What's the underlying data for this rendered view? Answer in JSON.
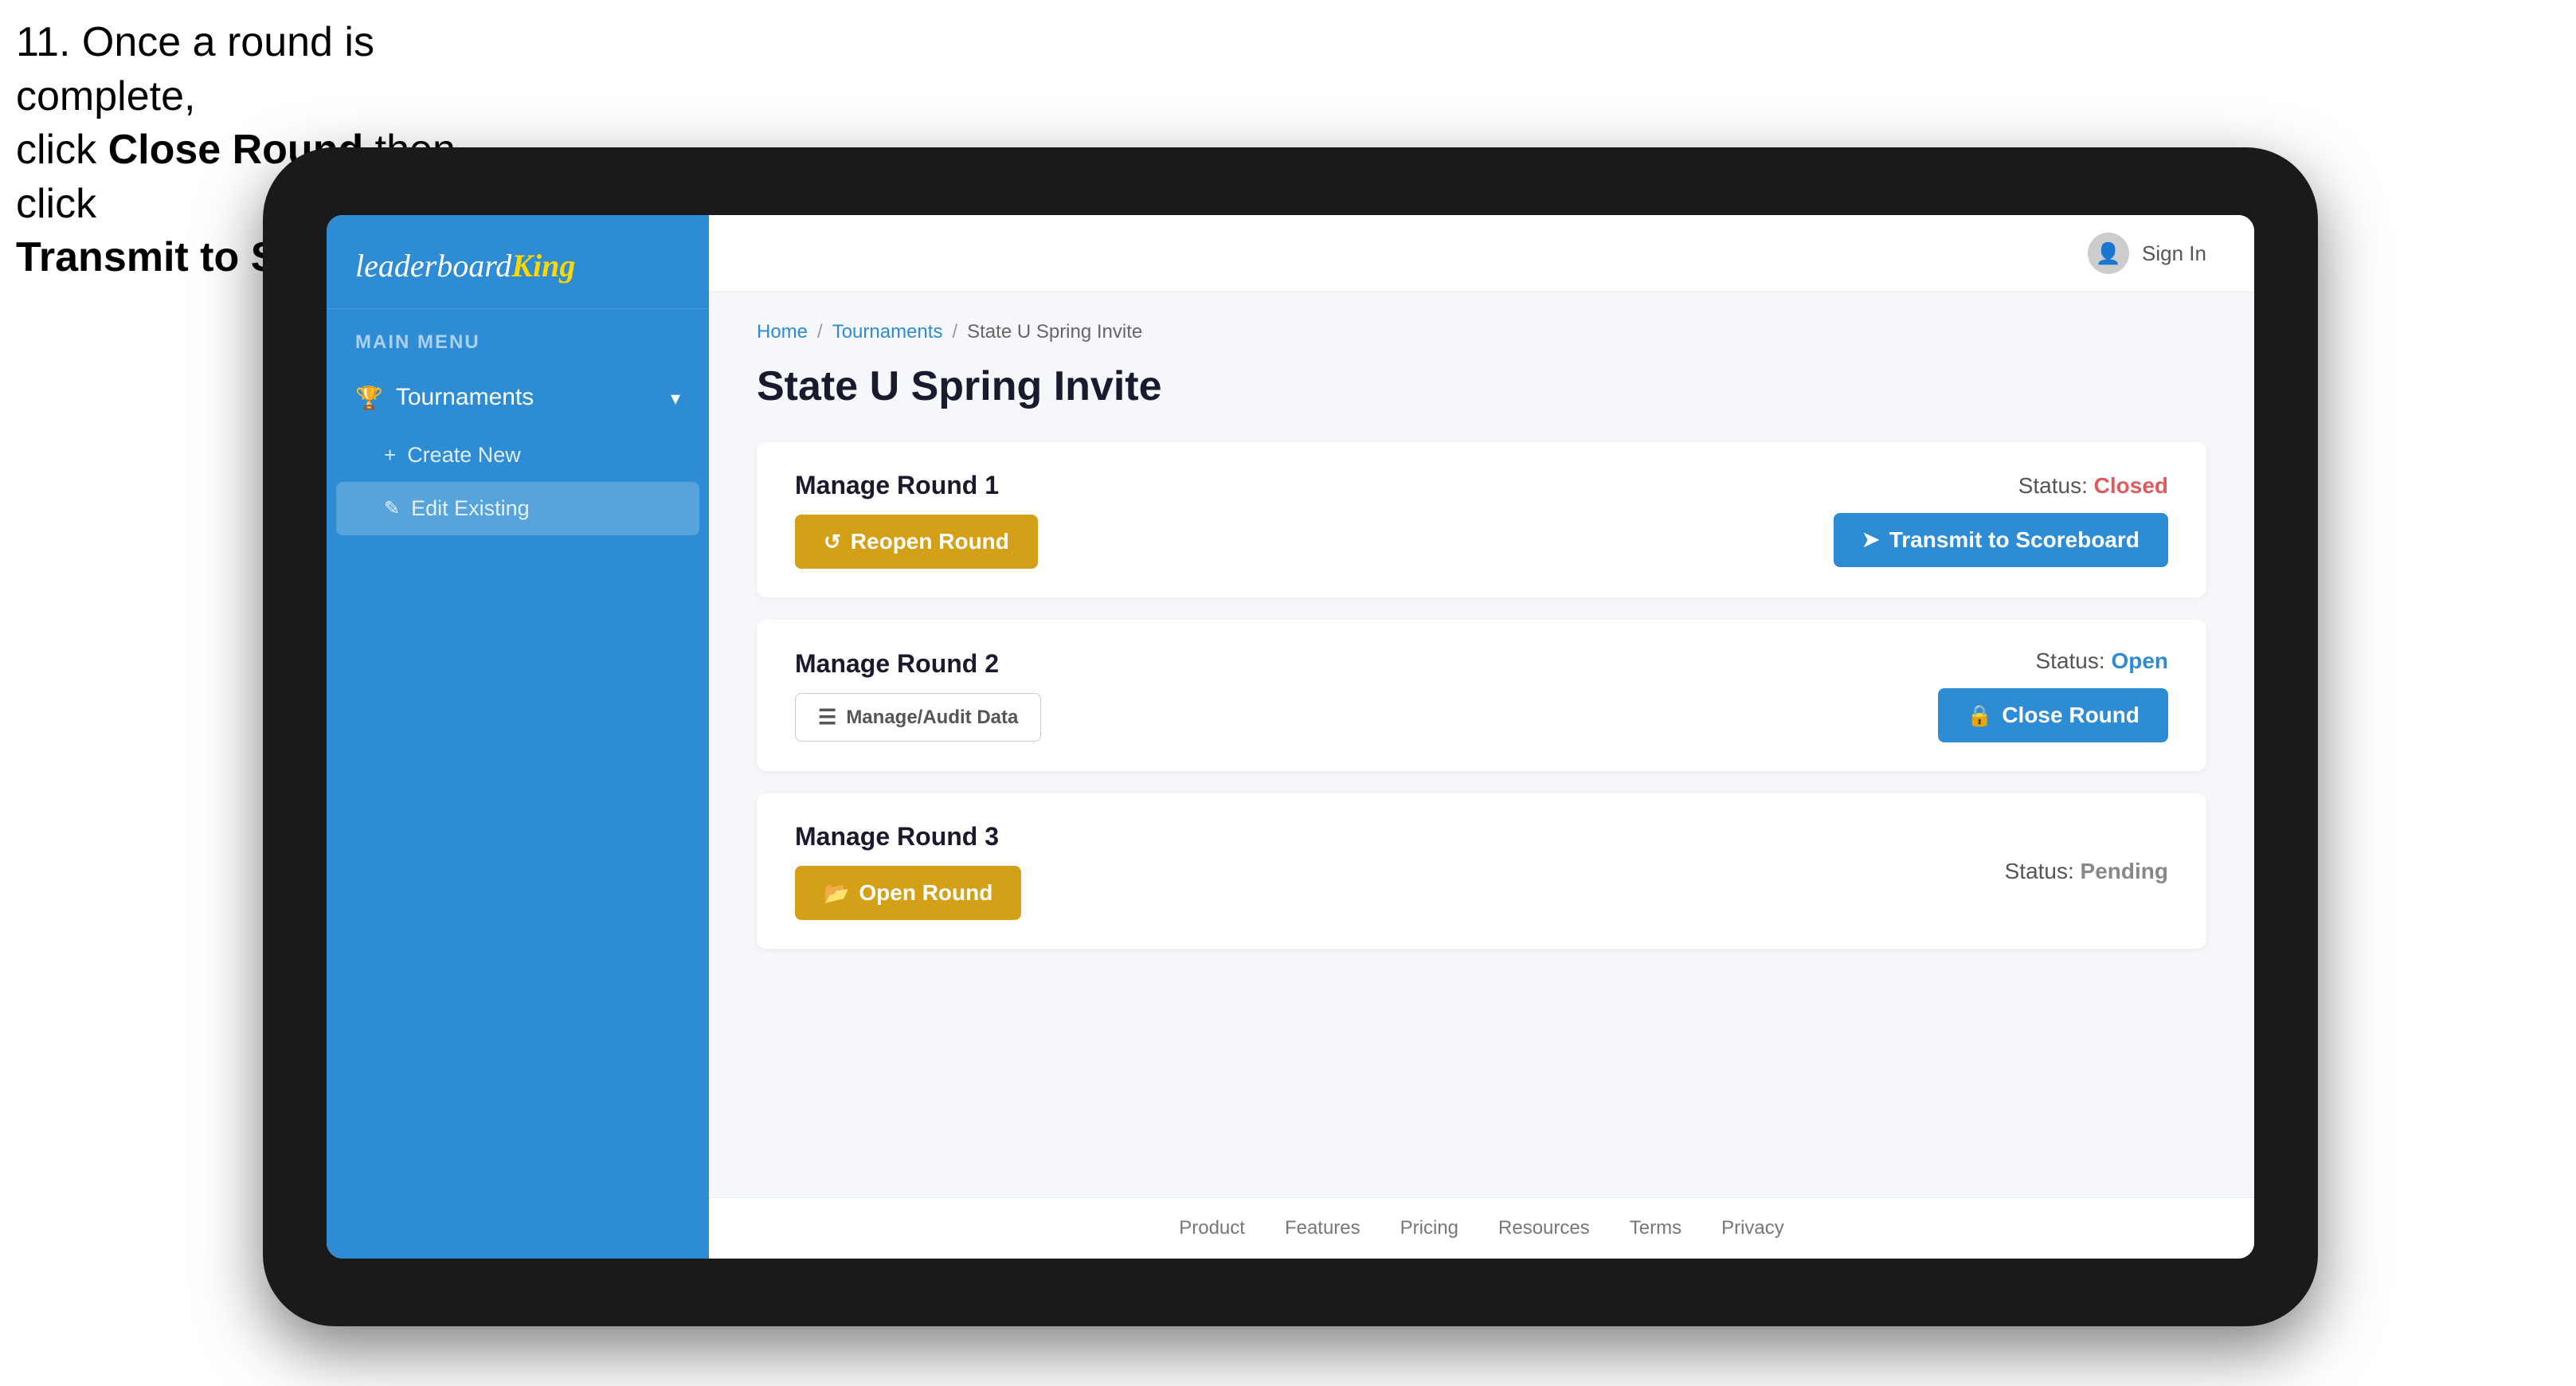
{
  "instruction": {
    "line1": "11. Once a round is complete,",
    "line2": "click ",
    "bold1": "Close Round",
    "line3": " then click",
    "bold2": "Transmit to Scoreboard."
  },
  "logo": {
    "leaderboard": "leaderboard",
    "king": "King"
  },
  "sidebar": {
    "menu_label": "MAIN MENU",
    "tournaments_label": "Tournaments",
    "create_new_label": "Create New",
    "edit_existing_label": "Edit Existing"
  },
  "topnav": {
    "sign_in": "Sign In"
  },
  "breadcrumb": {
    "home": "Home",
    "tournaments": "Tournaments",
    "current": "State U Spring Invite"
  },
  "page": {
    "title": "State U Spring Invite"
  },
  "rounds": [
    {
      "id": "round1",
      "title": "Manage Round 1",
      "status_label": "Status:",
      "status": "Closed",
      "status_class": "status-closed",
      "btn_label": "Reopen Round",
      "btn_class": "btn-orange",
      "btn2_label": "Transmit to Scoreboard",
      "btn2_class": "btn-blue",
      "btn_icon": "↺",
      "btn2_icon": "➤"
    },
    {
      "id": "round2",
      "title": "Manage Round 2",
      "status_label": "Status:",
      "status": "Open",
      "status_class": "status-open",
      "btn_label": "Manage/Audit Data",
      "btn_class": "btn-blue-outline",
      "btn2_label": "Close Round",
      "btn2_class": "btn-blue",
      "btn_icon": "☰",
      "btn2_icon": "🔒"
    },
    {
      "id": "round3",
      "title": "Manage Round 3",
      "status_label": "Status:",
      "status": "Pending",
      "status_class": "status-pending",
      "btn_label": "Open Round",
      "btn_class": "btn-orange",
      "btn_icon": "📂"
    }
  ],
  "footer": {
    "links": [
      "Product",
      "Features",
      "Pricing",
      "Resources",
      "Terms",
      "Privacy"
    ]
  }
}
